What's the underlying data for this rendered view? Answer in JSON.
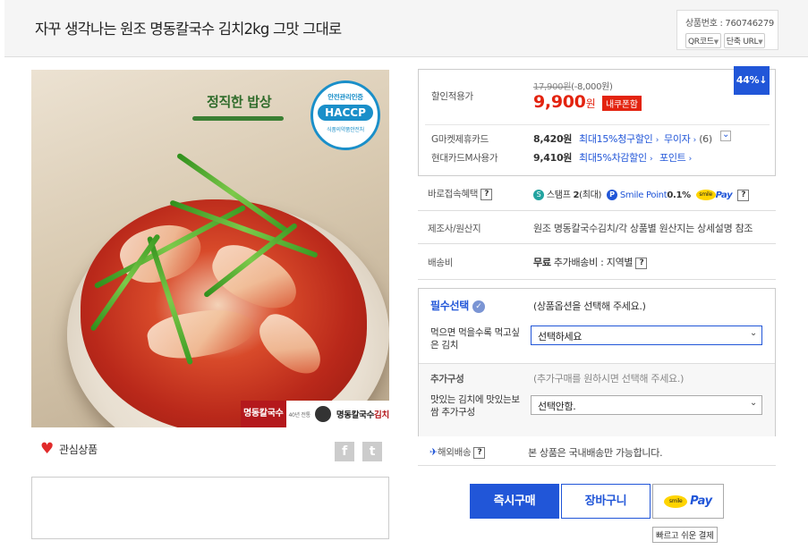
{
  "header": {
    "title": "자꾸 생각나는 원조 명동칼국수 김치2kg 그맛 그대로",
    "product_no": "상품번호 : 760746279",
    "qr_label": "QR코드",
    "short_url_label": "단축 URL"
  },
  "image": {
    "logo_text": "정직한 밥상",
    "haccp_top": "안전관리인증",
    "haccp_main": "HACCP",
    "haccp_bottom": "식품의약품안전처",
    "brand_box": "명동칼국수",
    "brand_small": "40년 전통",
    "brand_name_prefix": "명동칼국수",
    "brand_name_suffix": "김치"
  },
  "left": {
    "favorite_label": "관심상품",
    "facebook": "f",
    "twitter": "t"
  },
  "price": {
    "discount_badge": "44%",
    "discount_arrow": "↓",
    "discount_label": "할인적용가",
    "original": "17,900원",
    "discount_amount": "(-8,000원)",
    "current": "9,900",
    "won": "원",
    "tag": "내쿠폰함"
  },
  "cards": [
    {
      "label": "G마켓제휴카드",
      "price": "8,420원",
      "benefit": "최대15%청구할인",
      "arrow": "›",
      "extra": "무이자",
      "extra_arrow": "›",
      "count": "(6)",
      "expand": "⌄"
    },
    {
      "label": "현대카드M사용가",
      "price": "9,410원",
      "benefit": "최대5%차감할인",
      "arrow": "›",
      "extra": "포인트",
      "extra_arrow": "›"
    }
  ],
  "benefit": {
    "label": "바로접속혜택",
    "qmark": "?",
    "stamp_icon": "S",
    "stamp_label": "스탬프",
    "stamp_count": "2",
    "stamp_max": "(최대)",
    "smile_point_label": "Smile Point",
    "smile_point_value": "0.1%",
    "smile_text": "smile",
    "pay_text": "Pay",
    "qmark2": "?"
  },
  "origin": {
    "label": "제조사/원산지",
    "value": "원조 명동칼국수김치/각 상품별 원산지는 상세설명 참조"
  },
  "shipping": {
    "label": "배송비",
    "free": "무료",
    "extra": "추가배송비 : 지역별",
    "qmark": "?"
  },
  "options": {
    "required_label": "필수선택",
    "check": "✓",
    "required_hint": "(상품옵션을 선택해 주세요.)",
    "option1_label": "먹으면 먹을수록 먹고싶은 김치",
    "option1_value": "선택하세요",
    "addon_label": "추가구성",
    "addon_hint": "(추가구매를 원하시면 선택해 주세요.)",
    "option2_label": "맛있는 김치에 맛있는보쌈 추가구성",
    "option2_value": "선택안함.",
    "chevron": "⌄"
  },
  "overseas": {
    "plane": "✈",
    "label": "해외배송",
    "qmark": "?",
    "value": "본 상품은 국내배송만 가능합니다."
  },
  "buttons": {
    "buy": "즉시구매",
    "cart": "장바구니",
    "smile": "smile",
    "pay": "Pay",
    "tooltip": "빠르고 쉬운 결제"
  }
}
